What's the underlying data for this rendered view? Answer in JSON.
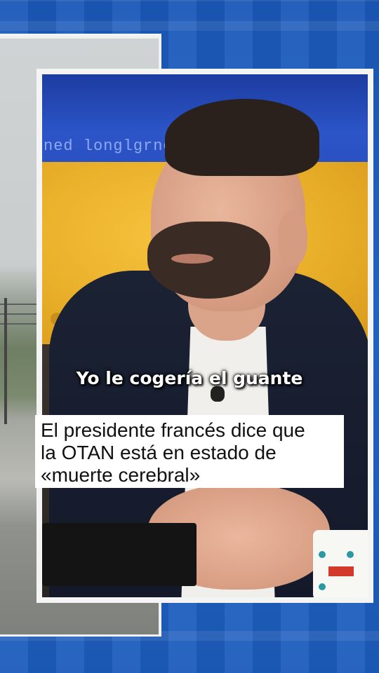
{
  "video": {
    "ticker_text": "ned longlgrne                            (i])",
    "subtitle": "Yo le cogería el guante"
  },
  "headline": {
    "lines": [
      "El presidente francés dice que",
      "la OTAN está en estado de",
      "«muerte cerebral»"
    ]
  },
  "colors": {
    "background_blue": "#1d5fbf",
    "chair_yellow": "#eab12b",
    "frame_white": "#f4f4f4",
    "headline_bg": "#ffffff"
  }
}
